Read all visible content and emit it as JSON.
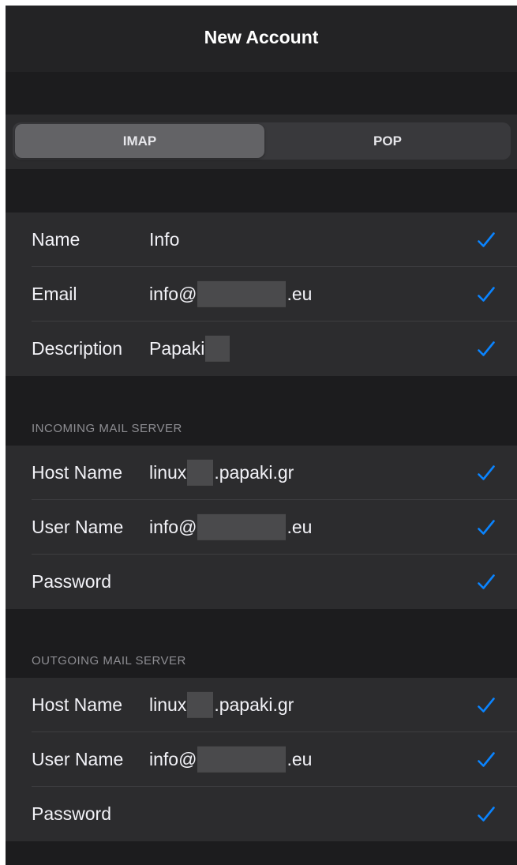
{
  "nav": {
    "title": "New Account"
  },
  "segmented": {
    "options": [
      "IMAP",
      "POP"
    ],
    "selected": "IMAP"
  },
  "account": {
    "rows": [
      {
        "label": "Name",
        "value": "Info"
      },
      {
        "label": "Email",
        "value_prefix": "info@",
        "value_suffix": ".eu"
      },
      {
        "label": "Description",
        "value": "Papaki"
      }
    ]
  },
  "incoming": {
    "header": "INCOMING MAIL SERVER",
    "rows": [
      {
        "label": "Host Name",
        "value_prefix": "linux",
        "value_suffix": ".papaki.gr"
      },
      {
        "label": "User Name",
        "value_prefix": "info@",
        "value_suffix": ".eu"
      },
      {
        "label": "Password"
      }
    ]
  },
  "outgoing": {
    "header": "OUTGOING MAIL SERVER",
    "rows": [
      {
        "label": "Host Name",
        "value_prefix": "linux",
        "value_suffix": ".papaki.gr"
      },
      {
        "label": "User Name",
        "value_prefix": "info@",
        "value_suffix": ".eu"
      },
      {
        "label": "Password"
      }
    ]
  },
  "icons": {
    "check": "checkmark-icon"
  },
  "colors": {
    "accent": "#0a84ff",
    "background": "#1c1c1e",
    "cell": "#2c2c2e"
  }
}
